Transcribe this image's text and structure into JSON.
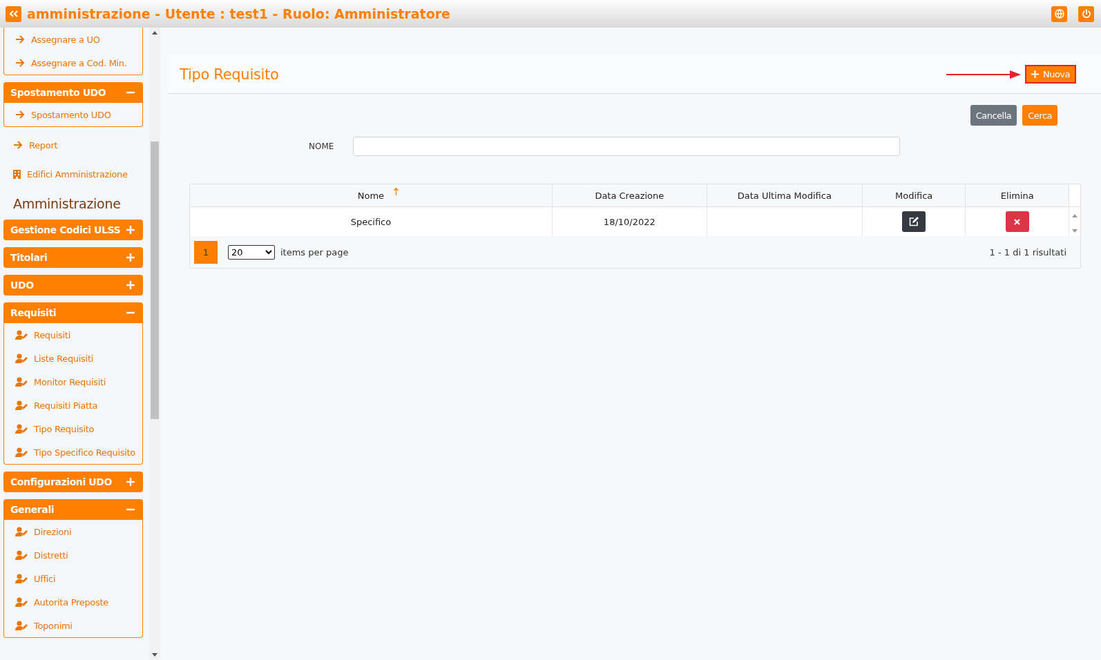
{
  "header": {
    "title": "amministrazione - Utente : test1 - Ruolo: Amministratore"
  },
  "sidebar": {
    "items": [
      {
        "kind": "tail",
        "children": [
          {
            "label": "Assegnare a UO",
            "kind": "arrow"
          },
          {
            "label": "Assegnare a Cod. Min.",
            "kind": "arrow"
          }
        ]
      },
      {
        "kind": "group",
        "title": "Spostamento UDO",
        "expanded": true,
        "children": [
          {
            "label": "Spostamento UDO",
            "kind": "arrow"
          }
        ]
      },
      {
        "kind": "link",
        "label": "Report"
      },
      {
        "kind": "building",
        "label": "Edifici Amministrazione"
      },
      {
        "kind": "heading",
        "label": "Amministrazione"
      },
      {
        "kind": "group",
        "title": "Gestione Codici ULSS",
        "expanded": false
      },
      {
        "kind": "group",
        "title": "Titolari",
        "expanded": false
      },
      {
        "kind": "group",
        "title": "UDO",
        "expanded": false
      },
      {
        "kind": "group",
        "title": "Requisiti",
        "expanded": true,
        "children": [
          {
            "label": "Requisiti",
            "kind": "user"
          },
          {
            "label": "Liste Requisiti",
            "kind": "user"
          },
          {
            "label": "Monitor Requisiti",
            "kind": "user"
          },
          {
            "label": "Requisiti Piatta",
            "kind": "user"
          },
          {
            "label": "Tipo Requisito",
            "kind": "user"
          },
          {
            "label": "Tipo Specifico Requisito",
            "kind": "user"
          }
        ]
      },
      {
        "kind": "group",
        "title": "Configurazioni UDO",
        "expanded": false
      },
      {
        "kind": "group",
        "title": "Generali",
        "expanded": true,
        "children": [
          {
            "label": "Direzioni",
            "kind": "user"
          },
          {
            "label": "Distretti",
            "kind": "user"
          },
          {
            "label": "Uffici",
            "kind": "user"
          },
          {
            "label": "Autorita Preposte",
            "kind": "user"
          },
          {
            "label": "Toponimi",
            "kind": "user"
          }
        ]
      }
    ]
  },
  "main": {
    "title": "Tipo Requisito",
    "new_button": "Nuova",
    "search_buttons": [
      {
        "label": "Cancella",
        "kind": "secondary"
      },
      {
        "label": "Cerca",
        "kind": "primary"
      }
    ],
    "filter": {
      "label": "NOME"
    },
    "table": {
      "columns": [
        {
          "label": "Nome",
          "sorted": true
        },
        {
          "label": "Data Creazione",
          "sorted": false
        },
        {
          "label": "Data Ultima Modifica",
          "sorted": false
        },
        {
          "label": "Modifica",
          "sorted": false
        },
        {
          "label": "Elimina",
          "sorted": false
        }
      ],
      "rows": [
        {
          "nome": "Specifico",
          "data_creazione": "18/10/2022"
        }
      ]
    },
    "pager": {
      "pages": [
        {
          "label": "1",
          "selected": true
        }
      ],
      "page_size": "20",
      "page_size_label": "items per page",
      "summary": "1 - 1 di 1 risultati"
    }
  }
}
